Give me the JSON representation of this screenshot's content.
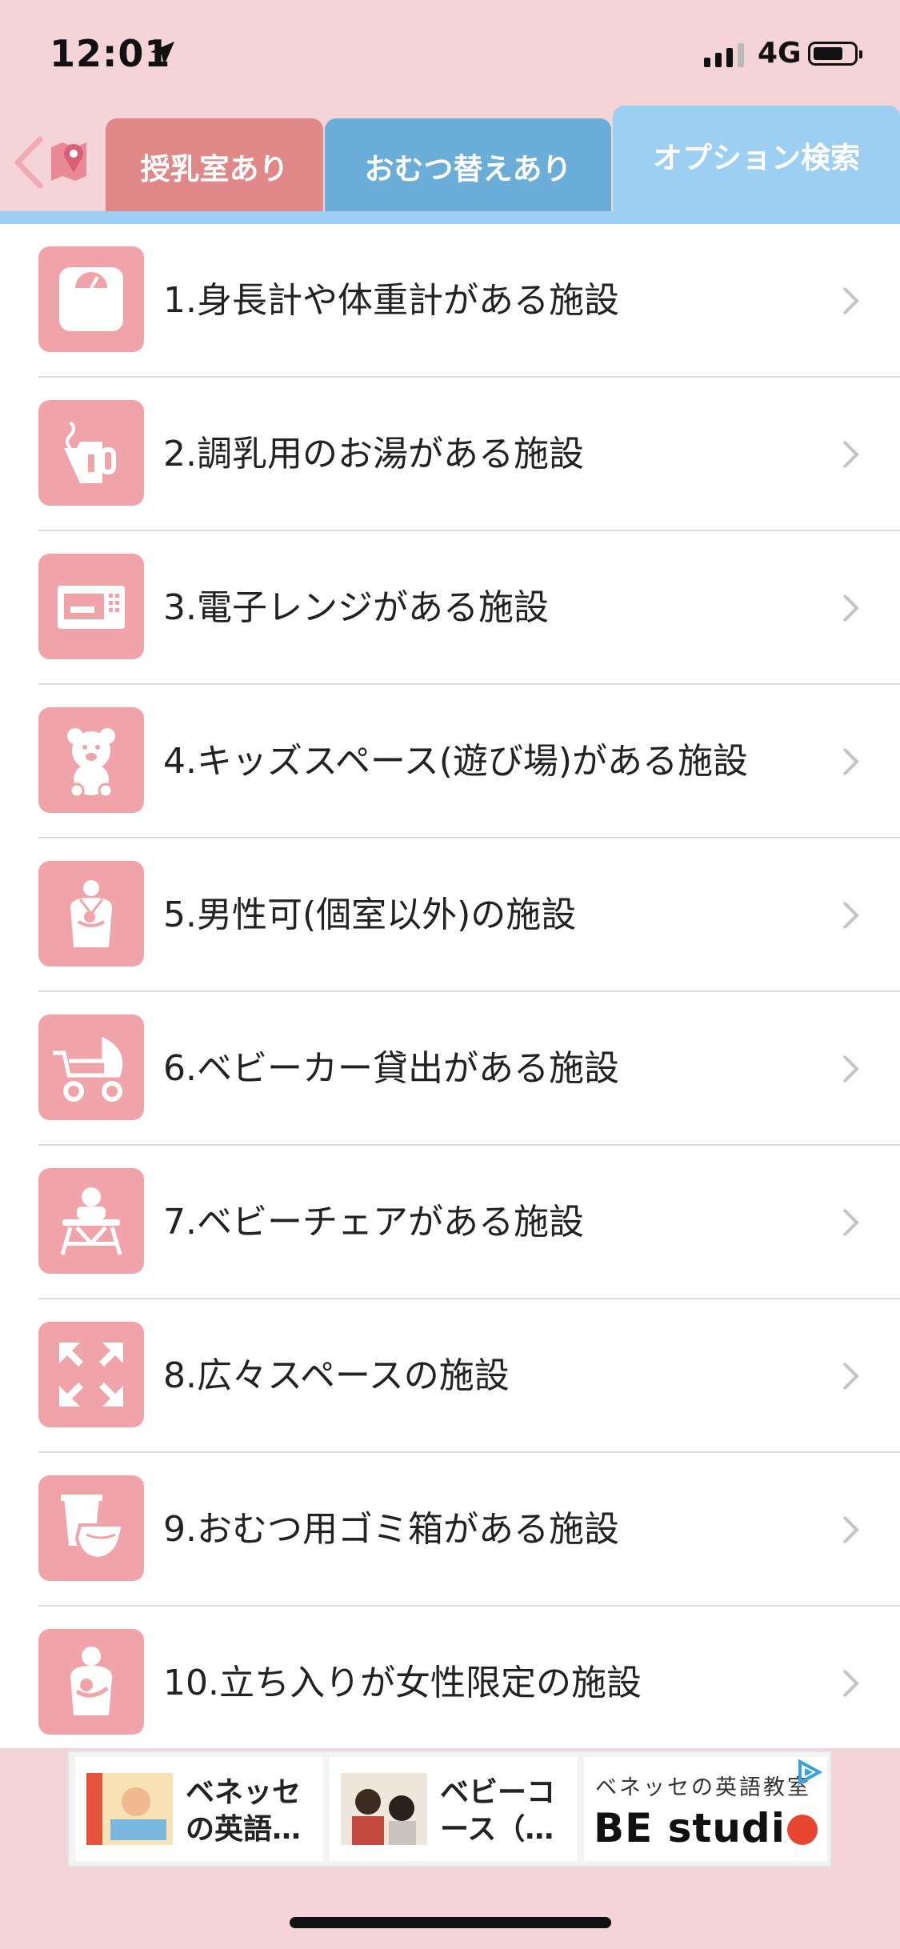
{
  "status": {
    "time": "12:01",
    "network": "4G"
  },
  "tabs": [
    {
      "label": "授乳室あり",
      "color": "#e08887"
    },
    {
      "label": "おむつ替えあり",
      "color": "#6aadd8"
    },
    {
      "label": "オプション検索",
      "color": "#9ccff2",
      "selected": true
    }
  ],
  "options": [
    {
      "label": "1.身長計や体重計がある施設",
      "icon": "scale-icon"
    },
    {
      "label": "2.調乳用のお湯がある施設",
      "icon": "hot-water-icon"
    },
    {
      "label": "3.電子レンジがある施設",
      "icon": "microwave-icon"
    },
    {
      "label": "4.キッズスペース(遊び場)がある施設",
      "icon": "teddy-bear-icon"
    },
    {
      "label": "5.男性可(個室以外)の施設",
      "icon": "father-baby-icon"
    },
    {
      "label": "6.ベビーカー貸出がある施設",
      "icon": "stroller-icon"
    },
    {
      "label": "7.ベビーチェアがある施設",
      "icon": "baby-chair-icon"
    },
    {
      "label": "8.広々スペースの施設",
      "icon": "expand-arrows-icon"
    },
    {
      "label": "9.おむつ用ゴミ箱がある施設",
      "icon": "diaper-bin-icon"
    },
    {
      "label": "10.立ち入りが女性限定の施設",
      "icon": "mother-baby-icon"
    }
  ],
  "ad": {
    "card1": "ベネッセの英語…",
    "card2": "ベビーコース（…",
    "card3_line1": "ベネッセの英語教室",
    "card3_brand_a": "BE studi",
    "card3_brand_b": ""
  },
  "colors": {
    "icon_bg": "#f0a4aa",
    "background": "#f5d4d8"
  }
}
